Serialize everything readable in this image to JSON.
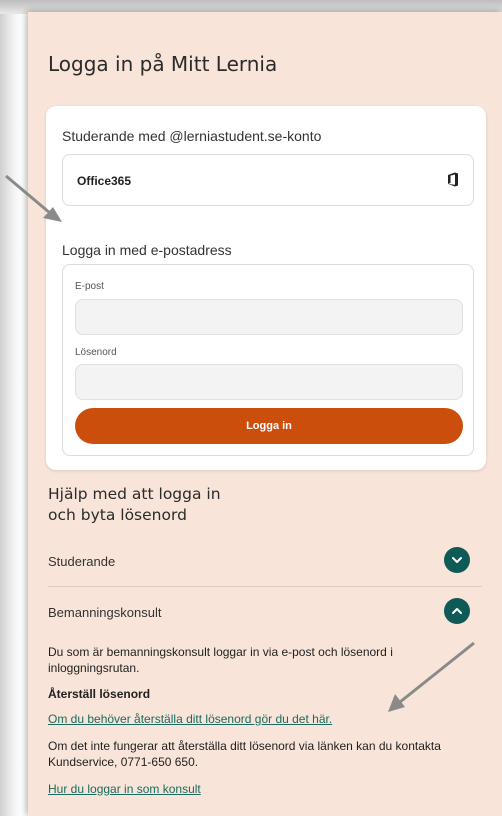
{
  "page_title": "Logga in på Mitt Lernia",
  "student_section": {
    "label": "Studerande med @lerniastudent.se-konto",
    "office_button_label": "Office365",
    "office_icon": "office-icon"
  },
  "email_section": {
    "label": "Logga in med e-postadress",
    "email_label": "E-post",
    "email_value": "",
    "password_label": "Lösenord",
    "password_value": "",
    "login_button_label": "Logga in"
  },
  "help": {
    "title_line1": "Hjälp med att logga in",
    "title_line2": "och byta lösenord",
    "items": [
      {
        "label": "Studerande",
        "expanded": false
      },
      {
        "label": "Bemanningskonsult",
        "expanded": true
      }
    ],
    "consultant_text": "Du som är bemanningskonsult loggar in via e-post och lösenord i inloggningsrutan.",
    "reset_heading": "Återställ lösenord",
    "reset_link": "Om du behöver återställa ditt lösenord gör du det här.",
    "fallback_text": "Om det inte fungerar att återställa ditt lösenord via länken kan du kontakta Kundservice, 0771-650 650.",
    "howto_link": "Hur du loggar in som konsult"
  },
  "colors": {
    "panel_bg": "#f8e4d8",
    "accent_orange": "#cc4e0d",
    "accent_teal": "#0f5a56",
    "link": "#1a6b5f"
  }
}
